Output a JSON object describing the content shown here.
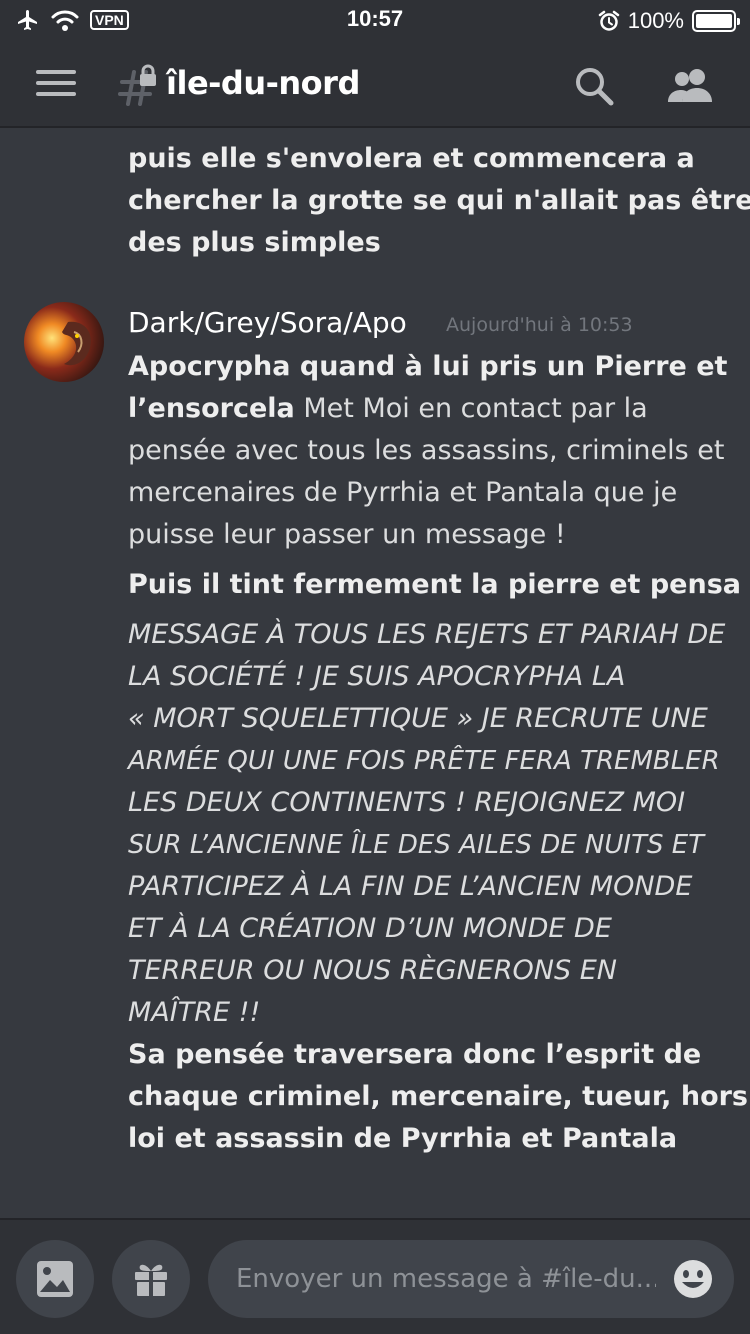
{
  "status_bar": {
    "time": "10:57",
    "vpn_label": "VPN",
    "battery": "100%",
    "icons": [
      "airplane-icon",
      "wifi-icon",
      "alarm-icon",
      "battery-icon"
    ]
  },
  "header": {
    "channel_name": "île-du-nord",
    "icons": [
      "menu-icon",
      "locked-channel-icon",
      "search-icon",
      "members-icon"
    ]
  },
  "messages": {
    "continuation_lines": [
      "puis elle s'envolera et commencera a",
      "chercher la grotte se qui n'allait pas être",
      "des plus simples"
    ],
    "post": {
      "author": "Dark/Grey/Sora/Apo",
      "timestamp": "Aujourd'hui à 10:53",
      "line1": "Apocrypha quand à lui pris un Pierre et",
      "line2_bold": "l’ensorcela",
      "line2_rest": " Met Moi en contact par la",
      "line3": "pensée avec tous les assassins, criminels et",
      "line4": "mercenaires de Pyrrhia et Pantala que je",
      "line5": "puisse leur passer un message !",
      "line6": "Puis il tint fermement la pierre et pensa",
      "italic_lines": [
        "MESSAGE À TOUS LES REJETS ET PARIAH DE",
        "LA SOCIÉTÉ ! JE SUIS APOCRYPHA LA",
        "« MORT SQUELETTIQUE »  JE RECRUTE UNE",
        "ARMÉE QUI UNE FOIS PRÊTE FERA TREMBLER",
        "LES DEUX CONTINENTS ! REJOIGNEZ MOI",
        "SUR L’ANCIENNE ÎLE DES AILES DE NUITS ET",
        "PARTICIPEZ À LA FIN DE L’ANCIEN MONDE",
        "ET À LA CRÉATION D’UN MONDE DE",
        "TERREUR OU NOUS RÈGNERONS EN",
        "MAÎTRE !!"
      ],
      "final_lines": [
        "Sa pensée traversera donc l’esprit de",
        "chaque criminel, mercenaire, tueur, hors la",
        "loi et assassin de Pyrrhia et Pantala"
      ]
    }
  },
  "composer": {
    "placeholder": "Envoyer un message à #île-du...",
    "icons": [
      "image-icon",
      "gift-icon",
      "emoji-icon"
    ]
  },
  "colors": {
    "background": "#36393f",
    "header_bg": "#2f3136",
    "input_bg": "#40444b",
    "text": "#dcddde",
    "muted": "#72767d"
  }
}
